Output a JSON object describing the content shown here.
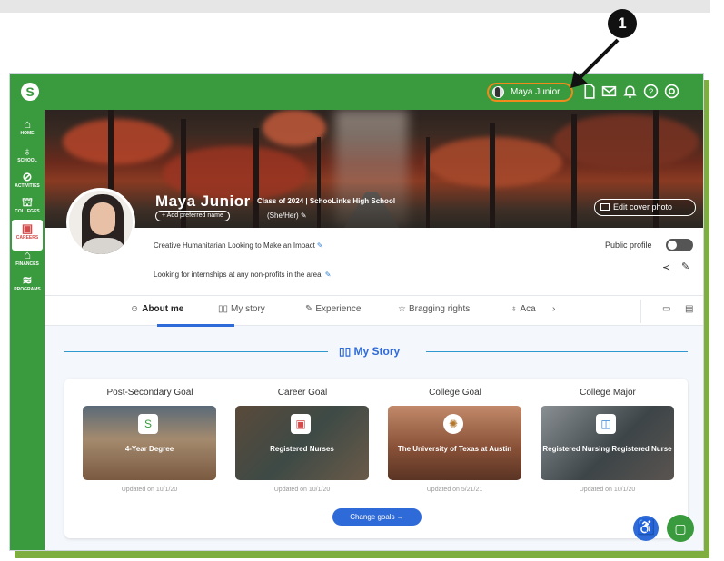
{
  "callout": {
    "number": "1"
  },
  "header": {
    "user_name": "Maya Junior",
    "icons": [
      "document-icon",
      "mail-icon",
      "bell-icon",
      "help-icon",
      "settings-icon"
    ]
  },
  "sidebar": {
    "items": [
      {
        "label": "HOME",
        "icon": "⌂"
      },
      {
        "label": "SCHOOL",
        "icon": "♁"
      },
      {
        "label": "ACTIVITIES",
        "icon": "⊘"
      },
      {
        "label": "COLLEGES",
        "icon": "⛫"
      },
      {
        "label": "CAREERS",
        "icon": "▣",
        "active": true
      },
      {
        "label": "FINANCES",
        "icon": "⌂"
      },
      {
        "label": "PROGRAMS",
        "icon": "≋"
      }
    ]
  },
  "profile": {
    "name": "Maya Junior",
    "class_info": "Class of 2024 | SchooLinks High School",
    "preferred_name_button": "+ Add preferred name",
    "pronouns": "(She/Her)",
    "edit_cover_label": "Edit cover photo",
    "bio_line1": "Creative Humanitarian Looking to Make an Impact",
    "bio_line2": "Looking for internships at any non-profits in the area!",
    "public_profile_label": "Public profile"
  },
  "tabs": [
    {
      "label": "About me",
      "icon": "☺",
      "active": true
    },
    {
      "label": "My story",
      "icon": "▯▯"
    },
    {
      "label": "Experience",
      "icon": "✎"
    },
    {
      "label": "Bragging rights",
      "icon": "☆"
    },
    {
      "label": "Aca",
      "icon": "♁"
    }
  ],
  "tab_scroll_arrow": "›",
  "section": {
    "title": "My Story"
  },
  "goals": [
    {
      "title": "Post-Secondary Goal",
      "value": "4-Year Degree",
      "updated": "Updated on 10/1/20",
      "icon": "S",
      "bg": "#7f6a58"
    },
    {
      "title": "Career Goal",
      "value": "Registered Nurses",
      "updated": "Updated on 10/1/20",
      "icon": "▣",
      "bg": "#3e4a46"
    },
    {
      "title": "College Goal",
      "value": "The University of Texas at Austin",
      "updated": "Updated on 5/21/21",
      "icon": "✺",
      "bg": "#8a5238"
    },
    {
      "title": "College Major",
      "value": "Registered Nursing Registered Nurse",
      "updated": "Updated on 10/1/20",
      "icon": "◫",
      "bg": "#3d4548"
    }
  ],
  "change_goals_label": "Change goals →",
  "colors": {
    "brand_green": "#3a9a3e",
    "accent_blue": "#2f6bd8",
    "highlight_orange": "#f08a1c"
  }
}
